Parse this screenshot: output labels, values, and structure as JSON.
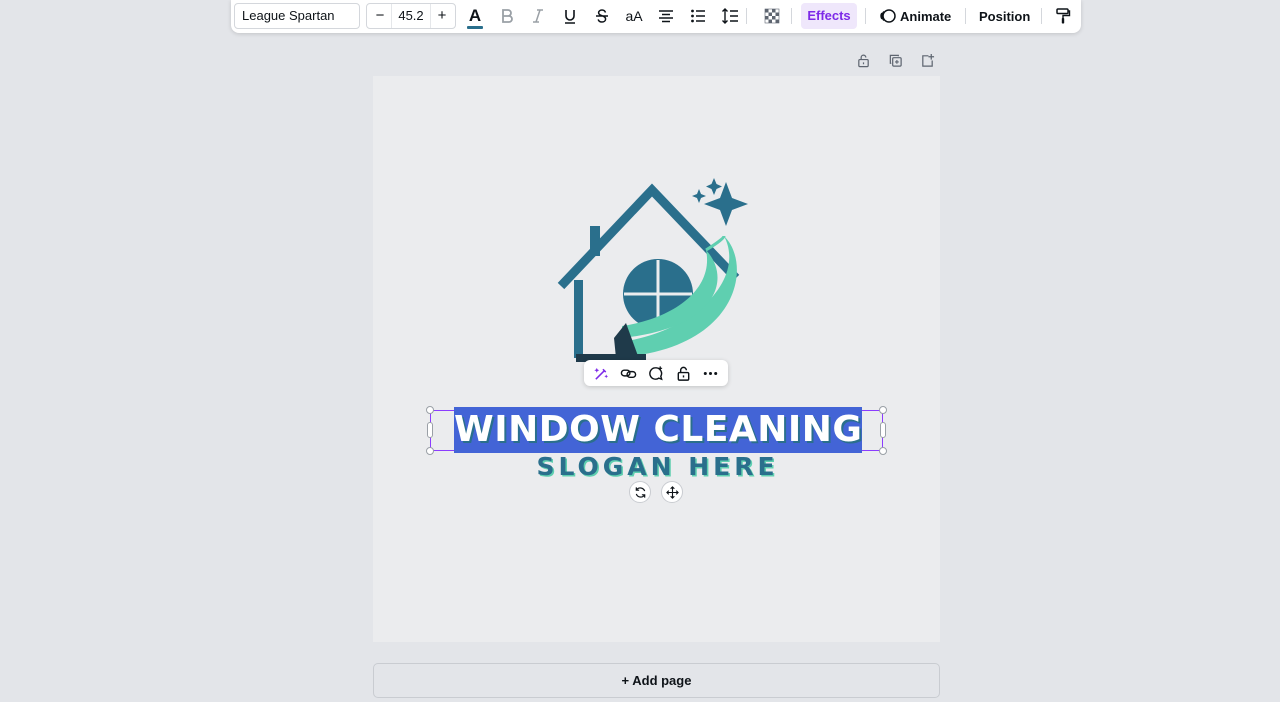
{
  "toolbar": {
    "font_name": "League Spartan",
    "font_size": "45.2",
    "decrease_label": "−",
    "increase_label": "+",
    "text_color": "#2a6f8c",
    "case_label": "aA",
    "effects_label": "Effects",
    "animate_label": "Animate",
    "position_label": "Position",
    "icons": [
      "text-color-icon",
      "bold-icon",
      "italic-icon",
      "underline-icon",
      "strikethrough-icon",
      "letter-case-icon",
      "align-center-icon",
      "bullet-list-icon",
      "spacing-icon",
      "transparency-icon",
      "animate-icon",
      "paint-roller-icon"
    ]
  },
  "page_actions": {
    "icons": [
      "lock-icon",
      "duplicate-page-icon",
      "add-page-icon"
    ]
  },
  "canvas": {
    "heading": "WINDOW CLEANING",
    "slogan": "SLOGAN HERE",
    "colors": {
      "teal_dark": "#2a6f8c",
      "mint": "#5fcfb0",
      "selection_highlight": "#4364d6",
      "selection_border": "#8b3dff"
    }
  },
  "context_menu": {
    "icons": [
      "magic-edit-icon",
      "link-icon",
      "comment-icon",
      "lock-icon",
      "more-icon"
    ]
  },
  "controls": {
    "icons": [
      "rotate-icon",
      "move-icon"
    ]
  },
  "add_page_label": "+ Add page"
}
